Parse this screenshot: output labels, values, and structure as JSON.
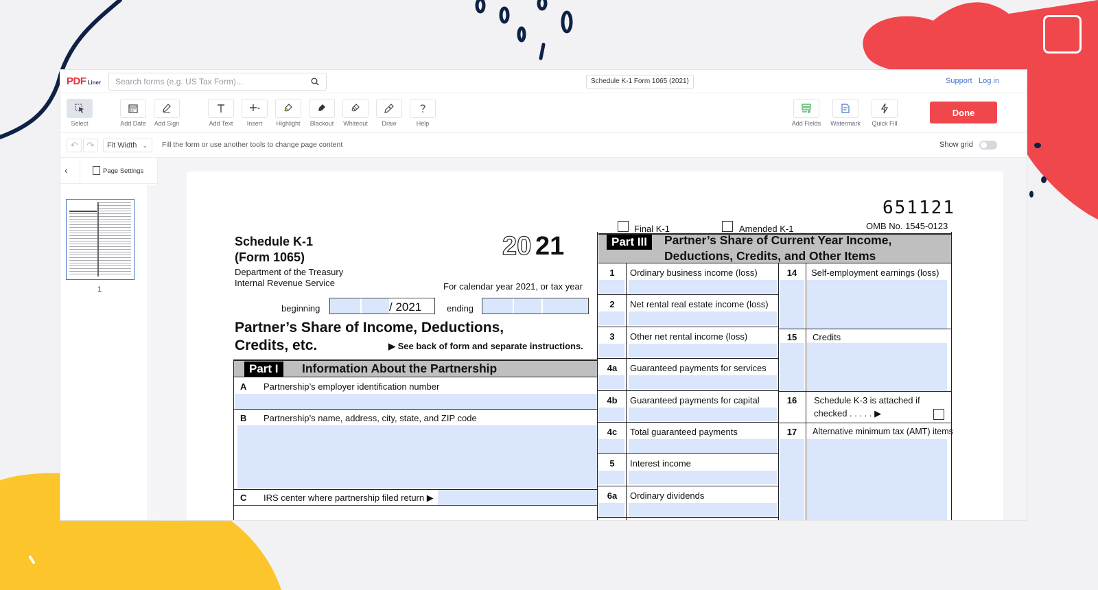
{
  "app": {
    "logo_main": "PDF",
    "logo_sub": "Liner",
    "search_placeholder": "Search forms (e.g. US Tax Form)...",
    "doc_title": "Schedule K-1 Form 1065 (2021)",
    "support_label": "Support",
    "login_label": "Log in"
  },
  "toolbar": {
    "tools": [
      {
        "label": "Select",
        "icon": "cursor-icon"
      },
      {
        "label": "Add Date",
        "icon": "calendar-icon"
      },
      {
        "label": "Add Sign",
        "icon": "pen-sign-icon"
      },
      {
        "label": "Add Text",
        "icon": "text-t-icon"
      },
      {
        "label": "Insert",
        "icon": "plus-icon"
      },
      {
        "label": "Highlight",
        "icon": "highlighter-icon"
      },
      {
        "label": "Blackout",
        "icon": "blackout-marker-icon"
      },
      {
        "label": "Whiteout",
        "icon": "eraser-icon"
      },
      {
        "label": "Draw",
        "icon": "draw-pen-icon"
      },
      {
        "label": "Help",
        "icon": "question-icon"
      }
    ],
    "right_tools": [
      {
        "label": "Add Fields",
        "icon": "add-fields-icon"
      },
      {
        "label": "Watermark",
        "icon": "watermark-icon"
      },
      {
        "label": "Quick Fill",
        "icon": "lightning-icon"
      }
    ],
    "done_label": "Done"
  },
  "subbar": {
    "zoom_value": "Fit Width",
    "hint": "Fill the form or use another tools to change page content",
    "show_grid_label": "Show grid"
  },
  "sidebar": {
    "page_settings_label": "Page Settings",
    "thumb_page_number": "1"
  },
  "form": {
    "barcode": "651121",
    "omb": "OMB No. 1545-0123",
    "final_k1": "Final K-1",
    "amended_k1": "Amended K-1",
    "schedule_title": "Schedule K-1",
    "form_number": "(Form 1065)",
    "dept": "Department of the Treasury",
    "irs": "Internal Revenue Service",
    "year_outline": "20",
    "year_bold": "21",
    "calendar_text": "For calendar year 2021, or tax year",
    "beginning_label": "beginning",
    "beginning_year": "/ 2021",
    "ending_label": "ending",
    "main_title_1": "Partner’s Share of Income, Deductions,",
    "main_title_2": "Credits, etc.",
    "see_back": "▶ See back of form and separate instructions.",
    "part1_tag": "Part I",
    "part1_title": "Information About the Partnership",
    "rowA_letter": "A",
    "rowA_label": "Partnership’s employer identification number",
    "rowB_letter": "B",
    "rowB_label": "Partnership’s name, address, city, state, and ZIP code",
    "rowC_letter": "C",
    "rowC_label": "IRS center where partnership filed return ▶",
    "part3_tag": "Part III",
    "part3_title_1": "Partner’s Share of Current Year Income,",
    "part3_title_2": "Deductions, Credits, and Other Items",
    "left_lines": [
      {
        "num": "1",
        "label": "Ordinary business income (loss)"
      },
      {
        "num": "2",
        "label": "Net rental real estate income (loss)"
      },
      {
        "num": "3",
        "label": "Other net rental income (loss)"
      },
      {
        "num": "4a",
        "label": "Guaranteed payments for services"
      },
      {
        "num": "4b",
        "label": "Guaranteed payments for capital"
      },
      {
        "num": "4c",
        "label": "Total guaranteed payments"
      },
      {
        "num": "5",
        "label": "Interest income"
      },
      {
        "num": "6a",
        "label": "Ordinary dividends"
      }
    ],
    "right_lines": {
      "l14_num": "14",
      "l14_label": "Self-employment earnings (loss)",
      "l15_num": "15",
      "l15_label": "Credits",
      "l16_num": "16",
      "l16_label_1": "Schedule K-3 is attached if",
      "l16_label_2": "checked . . . . . ▶",
      "l17_num": "17",
      "l17_label": "Alternative minimum tax (AMT) items"
    }
  },
  "colors": {
    "brand_red": "#f0474d",
    "link_blue": "#4a74c9",
    "field_fill": "#d9e6fb",
    "deco_yellow": "#fcc52b",
    "deco_navy": "#0e2245"
  }
}
